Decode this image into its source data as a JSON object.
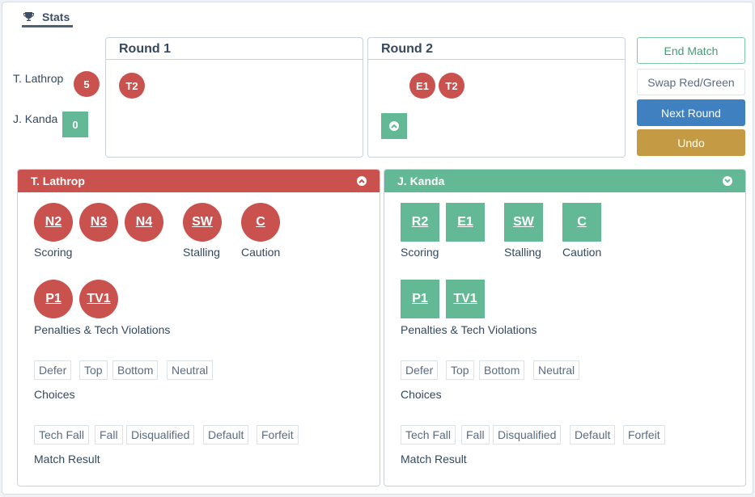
{
  "tab": {
    "label": "Stats",
    "icon": "trophy-icon"
  },
  "scoreboard": {
    "red": {
      "name": "T. Lathrop",
      "score": "5"
    },
    "green": {
      "name": "J. Kanda",
      "score": "0"
    }
  },
  "rounds": [
    {
      "title": "Round 1",
      "red_events": [
        "T2"
      ],
      "green_events": []
    },
    {
      "title": "Round 2",
      "red_events": [
        "E1",
        "T2"
      ],
      "green_events": [],
      "green_indicator_icon": "chevron-up-circle-icon"
    }
  ],
  "actions": {
    "end_match": "End Match",
    "swap": "Swap Red/Green",
    "next_round": "Next Round",
    "undo": "Undo"
  },
  "panels": {
    "red": {
      "name": "T. Lathrop",
      "toggle_icon": "chevron-up-circle-icon",
      "scoring": [
        "N2",
        "N3",
        "N4"
      ],
      "scoring_label": "Scoring",
      "stalling": "SW",
      "stalling_label": "Stalling",
      "caution": "C",
      "caution_label": "Caution",
      "penalties": [
        "P1",
        "TV1"
      ],
      "penalties_label": "Penalties & Tech Violations",
      "choices": [
        "Defer",
        "Top",
        "Bottom",
        "Neutral"
      ],
      "choices_label": "Choices",
      "results": [
        "Tech Fall",
        "Fall",
        "Disqualified",
        "Default",
        "Forfeit"
      ],
      "results_label": "Match Result"
    },
    "green": {
      "name": "J. Kanda",
      "toggle_icon": "chevron-down-circle-icon",
      "scoring": [
        "R2",
        "E1"
      ],
      "scoring_label": "Scoring",
      "stalling": "SW",
      "stalling_label": "Stalling",
      "caution": "C",
      "caution_label": "Caution",
      "penalties": [
        "P1",
        "TV1"
      ],
      "penalties_label": "Penalties & Tech Violations",
      "choices": [
        "Defer",
        "Top",
        "Bottom",
        "Neutral"
      ],
      "choices_label": "Choices",
      "results": [
        "Tech Fall",
        "Fall",
        "Disqualified",
        "Default",
        "Forfeit"
      ],
      "results_label": "Match Result"
    }
  },
  "colors": {
    "red": "#c9514e",
    "green": "#63b995",
    "blue": "#3f80c0",
    "gold": "#c59a45"
  }
}
